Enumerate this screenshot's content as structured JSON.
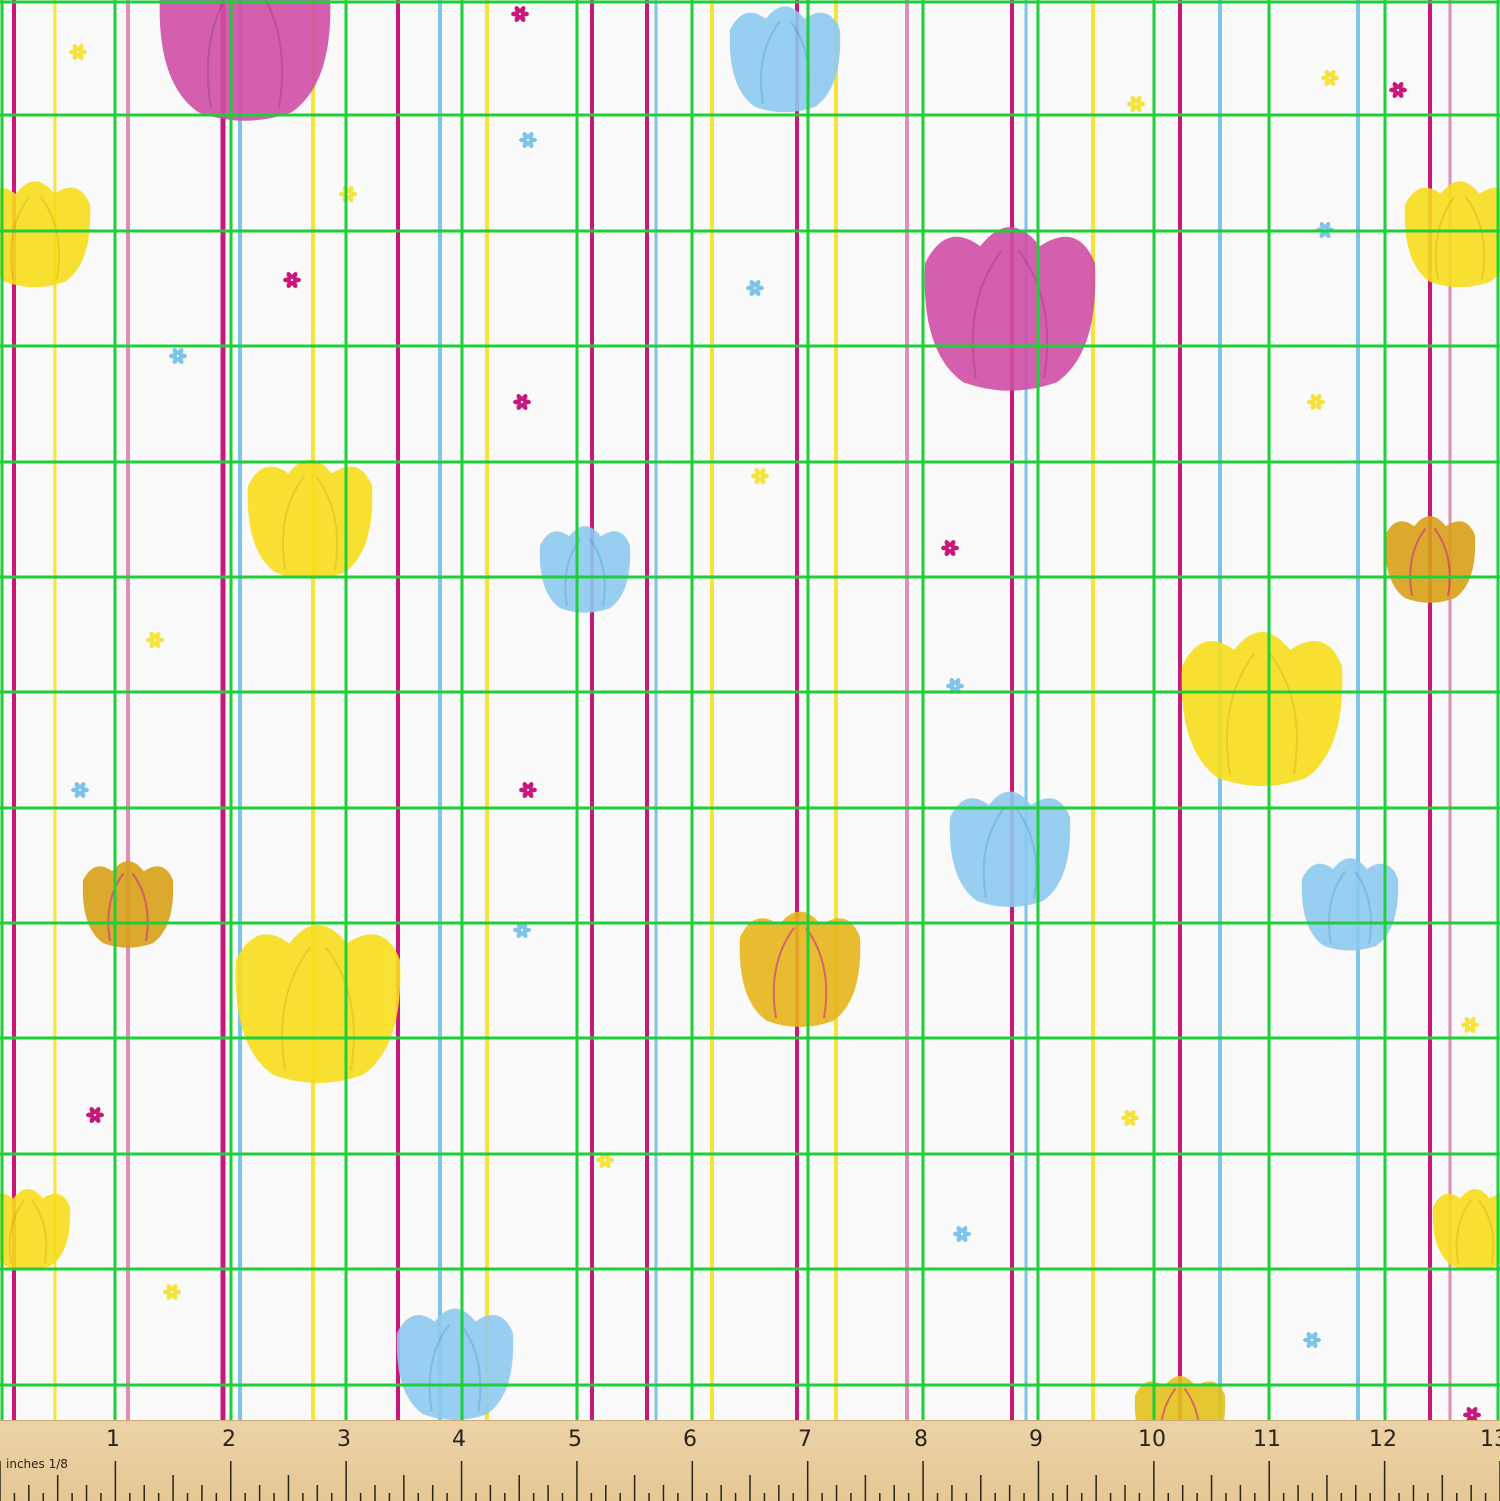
{
  "pattern": {
    "description_colors": {
      "background": "#fafafa",
      "grid": "#1ecf3a",
      "magenta": "#c8187a",
      "pink": "#e28ab8",
      "blue": "#7cc4ea",
      "yellow": "#f5e23a",
      "tulip_yellow": "#f7de1c",
      "tulip_blue": "#8ecaf0",
      "tulip_pink": "#cf4fa6"
    }
  },
  "ruler": {
    "unit_label": "inches 1/8",
    "numbers": [
      "1",
      "2",
      "3",
      "4",
      "5",
      "6",
      "7",
      "8",
      "9",
      "10",
      "11",
      "12",
      "13"
    ]
  }
}
